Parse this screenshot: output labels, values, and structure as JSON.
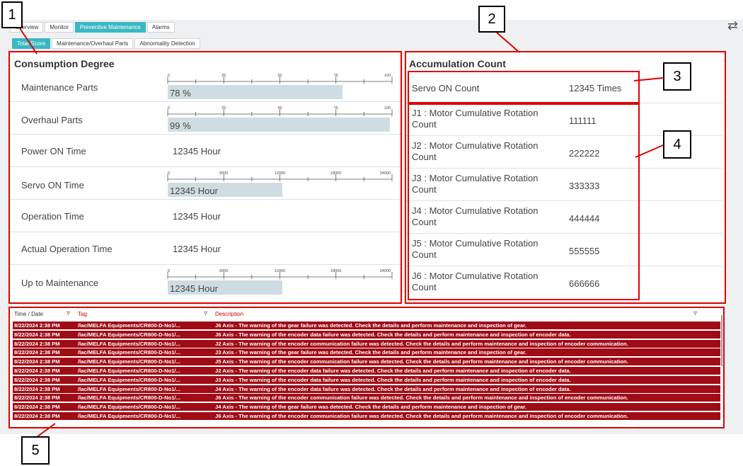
{
  "tabs": [
    "Overview",
    "Monitor",
    "Preventive Maintenance",
    "Alarms"
  ],
  "subtabs": [
    "Total Score",
    "Maintenance/Overhaul Parts",
    "Abnormality Detection"
  ],
  "consumption": {
    "title": "Consumption Degree",
    "maintenance_parts": {
      "label": "Maintenance Parts",
      "value_text": "78 %",
      "fill": 0.78,
      "ticks": [
        "0",
        "25",
        "50",
        "75",
        "100"
      ]
    },
    "overhaul_parts": {
      "label": "Overhaul Parts",
      "value_text": "99 %",
      "fill": 0.99,
      "ticks": [
        "0",
        "25",
        "50",
        "75",
        "100"
      ]
    },
    "power_on_time": {
      "label": "Power ON Time",
      "value": "12345 Hour"
    },
    "servo_on_time": {
      "label": "Servo ON Time",
      "value_text": "12345 Hour",
      "fill": 0.51,
      "ticks": [
        "0",
        "6000",
        "12000",
        "18000",
        "24000"
      ]
    },
    "operation_time": {
      "label": "Operation Time",
      "value": "12345 Hour"
    },
    "actual_operation_time": {
      "label": "Actual Operation Time",
      "value": "12345 Hour"
    },
    "up_to_maintenance": {
      "label": "Up to Maintenance",
      "value_text": "12345 Hour",
      "fill": 0.51,
      "ticks": [
        "0",
        "6000",
        "12000",
        "18000",
        "24000"
      ]
    }
  },
  "accumulation": {
    "title": "Accumulation Count",
    "servo_on": {
      "label": "Servo ON Count",
      "value": "12345 Times"
    },
    "joints": [
      {
        "label": "J1 : Motor Cumulative Rotation Count",
        "value": "111111"
      },
      {
        "label": "J2 : Motor Cumulative Rotation Count",
        "value": "222222"
      },
      {
        "label": "J3 : Motor Cumulative Rotation Count",
        "value": "333333"
      },
      {
        "label": "J4 : Motor Cumulative Rotation Count",
        "value": "444444"
      },
      {
        "label": "J5 : Motor Cumulative Rotation Count",
        "value": "555555"
      },
      {
        "label": "J6 : Motor Cumulative Rotation Count",
        "value": "666666"
      }
    ]
  },
  "alarm_table": {
    "headers": {
      "time": "Time / Date",
      "tag": "Tag",
      "description": "Description"
    },
    "rows": [
      {
        "time": "8/22/2024 2:38 PM",
        "tag": "/lac/MELFA Equipments/CR800-D-No1/...",
        "desc": "J6 Axis - The warning of the gear failure was detected. Check the details and perform maintenance and inspection of gear."
      },
      {
        "time": "8/22/2024 2:38 PM",
        "tag": "/lac/MELFA Equipments/CR800-D-No1/...",
        "desc": "J6 Axis - The warning of the encoder data failure was detected. Check the details and perform maintenance and inspection of encoder data."
      },
      {
        "time": "8/22/2024 2:38 PM",
        "tag": "/lac/MELFA Equipments/CR800-D-No1/...",
        "desc": "J2 Axis - The warning of the encoder communication failure was detected. Check the details and perform maintenance and inspection of encoder communication."
      },
      {
        "time": "8/22/2024 2:38 PM",
        "tag": "/lac/MELFA Equipments/CR800-D-No1/...",
        "desc": "J3 Axis - The warning of the gear failure was detected. Check the details and perform maintenance and inspection of gear."
      },
      {
        "time": "8/22/2024 2:38 PM",
        "tag": "/lac/MELFA Equipments/CR800-D-No1/...",
        "desc": "J5 Axis - The warning of the encoder communication failure was detected. Check the details and perform maintenance and inspection of encoder communication."
      },
      {
        "time": "8/22/2024 2:38 PM",
        "tag": "/lac/MELFA Equipments/CR800-D-No1/...",
        "desc": "J2 Axis - The warning of the encoder data failure was detected. Check the details and perform maintenance and inspection of encoder data."
      },
      {
        "time": "8/22/2024 2:38 PM",
        "tag": "/lac/MELFA Equipments/CR800-D-No1/...",
        "desc": "J3 Axis - The warning of the encoder data failure was detected. Check the details and perform maintenance and inspection of encoder data."
      },
      {
        "time": "8/22/2024 2:38 PM",
        "tag": "/lac/MELFA Equipments/CR800-D-No1/...",
        "desc": "J4 Axis - The warning of the encoder data failure was detected. Check the details and perform maintenance and inspection of encoder data."
      },
      {
        "time": "8/22/2024 2:38 PM",
        "tag": "/lac/MELFA Equipments/CR800-D-No1/...",
        "desc": "J6 Axis - The warning of the encoder communication failure was detected. Check the details and perform maintenance and inspection of encoder communication."
      },
      {
        "time": "8/22/2024 2:38 PM",
        "tag": "/lac/MELFA Equipments/CR800-D-No1/...",
        "desc": "J4 Axis - The warning of the gear failure was detected. Check the details and perform maintenance and inspection of gear."
      },
      {
        "time": "8/22/2024 2:38 PM",
        "tag": "/lac/MELFA Equipments/CR800-D-No1/...",
        "desc": "J6 Axis - The warning of the encoder communication failure was detected. Check the details and perform maintenance and inspection of encoder communication."
      }
    ]
  },
  "callouts": [
    "1",
    "2",
    "3",
    "4",
    "5"
  ],
  "colors": {
    "accent": "#3ab8c3",
    "alarm_row": "#a00c16",
    "callout": "#e00000",
    "bar": "#cfdde2"
  }
}
